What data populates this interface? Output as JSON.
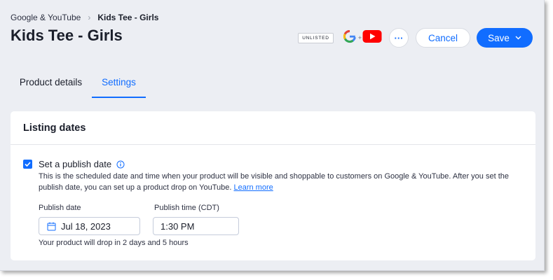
{
  "breadcrumb": {
    "parent": "Google & YouTube",
    "separator": "›",
    "current": "Kids Tee - Girls"
  },
  "page": {
    "title": "Kids Tee - Girls"
  },
  "header_actions": {
    "status_badge": "UNLISTED",
    "channels": [
      {
        "icon": "google-icon",
        "label": "G"
      },
      {
        "icon": "plus-icon",
        "label": "+"
      },
      {
        "icon": "youtube-icon"
      }
    ],
    "more_label": "···",
    "cancel_label": "Cancel",
    "save_label": "Save"
  },
  "tabs": [
    {
      "label": "Product details",
      "active": false
    },
    {
      "label": "Settings",
      "active": true
    }
  ],
  "listing_dates": {
    "title": "Listing dates",
    "publish_option": {
      "checked": true,
      "label": "Set a publish date",
      "description": "This is the scheduled date and time when your product will be visible and shoppable to customers on Google & YouTube. After you set the publish date, you can set up a product drop on YouTube.",
      "learn_more": "Learn more"
    },
    "publish_date": {
      "label": "Publish date",
      "value": "Jul 18, 2023"
    },
    "publish_time": {
      "label": "Publish time (CDT)",
      "value": "1:30 PM"
    },
    "drop_note": "Your product will drop in 2 days and 5 hours"
  },
  "colors": {
    "accent": "#116dff",
    "background": "#eceef3",
    "card": "#ffffff",
    "text": "#1b1f2b",
    "youtube_red": "#ff0000"
  }
}
